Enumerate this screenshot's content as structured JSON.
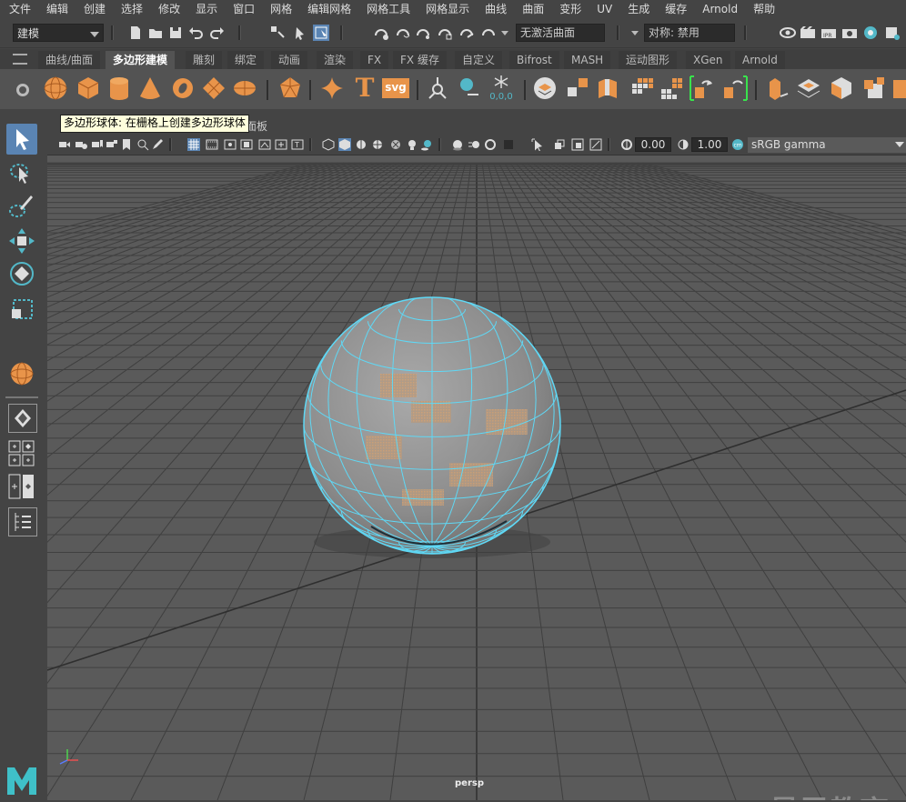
{
  "menubar": {
    "items": [
      "文件",
      "编辑",
      "创建",
      "选择",
      "修改",
      "显示",
      "窗口",
      "网格",
      "编辑网格",
      "网格工具",
      "网格显示",
      "曲线",
      "曲面",
      "变形",
      "UV",
      "生成",
      "缓存",
      "Arnold",
      "帮助"
    ]
  },
  "status_line": {
    "mode": "建模",
    "inactive_surface": "无激活曲面",
    "symmetry": "对称: 禁用"
  },
  "shelf": {
    "tabs": [
      "曲线/曲面",
      "多边形建模",
      "雕刻",
      "绑定",
      "动画",
      "渲染",
      "FX",
      "FX 缓存",
      "自定义",
      "Bifrost",
      "MASH",
      "运动图形",
      "XGen",
      "Arnold"
    ],
    "active_tab": "多边形建模",
    "svg_label": "svg",
    "tool_label_text": "T",
    "coord_label": "0,0,0"
  },
  "tooltip": {
    "text": "多边形球体: 在栅格上创建多边形球体"
  },
  "viewport": {
    "panel_menu_tail": "面板",
    "exposure": "0.00",
    "gamma": "1.00",
    "color_space": "sRGB gamma",
    "camera": "persp"
  },
  "watermark": {
    "text": "最需教育"
  },
  "colors": {
    "accent_orange": "#e8944a",
    "wire_cyan": "#5fd8f5",
    "highlight_blue": "#5a84b3"
  }
}
